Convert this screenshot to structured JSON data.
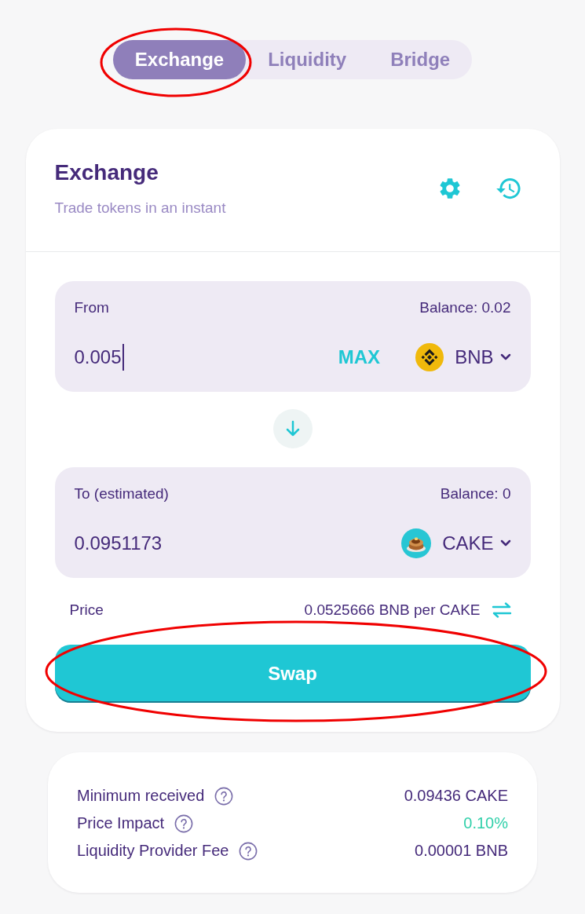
{
  "tabs": [
    {
      "label": "Exchange",
      "selected": true,
      "circled": true
    },
    {
      "label": "Liquidity",
      "selected": false,
      "circled": false
    },
    {
      "label": "Bridge",
      "selected": false,
      "circled": false
    }
  ],
  "card": {
    "title": "Exchange",
    "subtitle": "Trade tokens in an instant"
  },
  "from": {
    "label": "From",
    "balance": "Balance: 0.02",
    "value": "0.005",
    "focused": true,
    "max_label": "MAX",
    "token": "BNB"
  },
  "to": {
    "label": "To (estimated)",
    "balance": "Balance: 0",
    "value": "0.0951173",
    "focused": false,
    "token": "CAKE"
  },
  "price": {
    "label": "Price",
    "value": "0.0525666 BNB per CAKE"
  },
  "swap_button": {
    "label": "Swap",
    "circled": true
  },
  "details": [
    {
      "label": "Minimum received",
      "value": "0.09436 CAKE",
      "color": "#452a7a"
    },
    {
      "label": "Price Impact",
      "value": "0.10%",
      "color": "#31d0aa"
    },
    {
      "label": "Liquidity Provider Fee",
      "value": "0.00001 BNB",
      "color": "#452a7a"
    }
  ]
}
